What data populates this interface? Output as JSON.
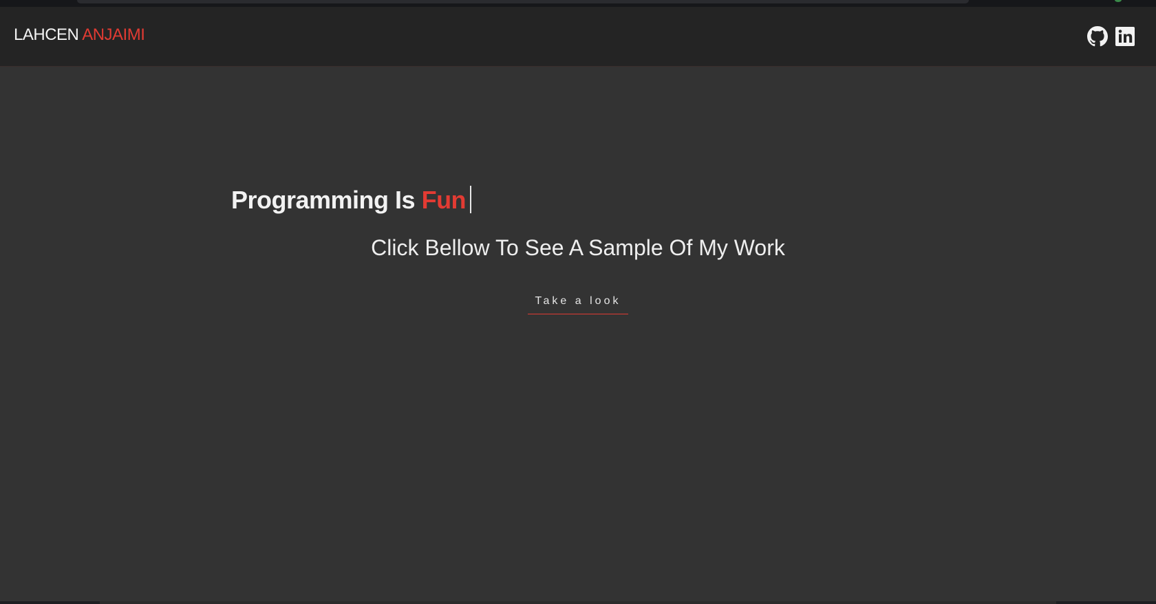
{
  "brand": {
    "first": "LAHCEN",
    "last": "ANJAIMI"
  },
  "social": {
    "github": "github-icon",
    "linkedin": "linkedin-icon"
  },
  "hero": {
    "headline_prefix": "Programming Is",
    "headline_accent": "Fun",
    "subtitle": "Click Bellow To See A Sample Of My Work",
    "cta_label": "Take a look"
  },
  "colors": {
    "accent": "#e23b33",
    "navbar_bg": "#242424",
    "main_bg": "#333333",
    "text": "#f2f2f2"
  }
}
